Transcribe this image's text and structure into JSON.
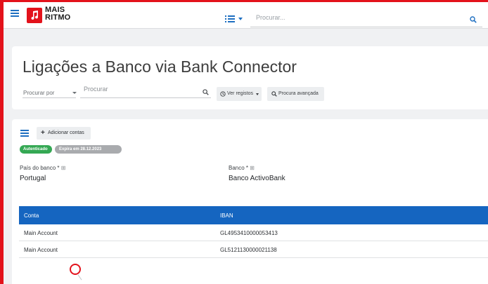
{
  "brand": {
    "line1": "MAIS",
    "line2": "RITMO",
    "accent": "#e3121b",
    "primary": "#1565c0"
  },
  "topbar": {
    "search_placeholder": "Procurar...",
    "icons": [
      "hamburger-icon",
      "list-view-icon",
      "search-icon"
    ]
  },
  "page": {
    "title": "Ligações a Banco via Bank Connector"
  },
  "filters": {
    "search_by_label": "Procurar por",
    "search_placeholder": "Procurar",
    "view_records_label": "Ver registos",
    "advanced_search_label": "Procura avançada"
  },
  "toolbar": {
    "add_accounts_label": "Adicionar contas"
  },
  "status": {
    "authenticated": "Autenticado",
    "expires": "Expira em 28.12.2023",
    "authenticated_color": "#34a853"
  },
  "fields": {
    "country_label": "País do banco *",
    "country_value": "Portugal",
    "bank_label": "Banco *",
    "bank_value": "Banco ActivoBank"
  },
  "table": {
    "columns": [
      "Conta",
      "IBAN"
    ],
    "rows": [
      {
        "account": "Main Account",
        "iban": "GL4953410000053413"
      },
      {
        "account": "Main Account",
        "iban": "GL5121130000021138"
      }
    ]
  }
}
